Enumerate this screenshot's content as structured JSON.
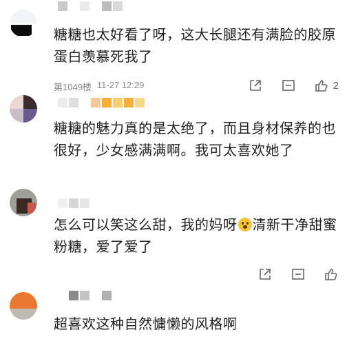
{
  "comments": [
    {
      "text": "糖糖也太好看了呀，这大长腿还有满脸的胶原蛋白羡慕死我了",
      "floor": "第1049楼",
      "time": "11-27 12:29",
      "like_count": "2",
      "avatar_colors": [
        "#0b0b0b",
        "#dfe7ee"
      ]
    },
    {
      "text": "糖糖的魅力真的是太绝了，而且身材保养的也很好，少女感满满啊。我可太喜欢她了",
      "avatar_colors": [
        "#3a2c2a",
        "#6a5b8e",
        "#e9d7d0"
      ]
    },
    {
      "text_before_emoji": "怎么可以笑这么甜，我的妈呀",
      "text_after_emoji": "清新干净甜蜜粉糖，爱了爱了",
      "emoji_name": "scared-face-emoji",
      "avatar_colors": [
        "#8b8f86",
        "#3b2a24"
      ]
    },
    {
      "text": "超喜欢这种自然慵懒的风格啊",
      "avatar_colors": [
        "#e9792e",
        "#bfb9b3"
      ]
    }
  ],
  "icons": {
    "share": "share-icon",
    "reply": "comment-icon",
    "like": "thumbs-up-icon"
  },
  "colors": {
    "text": "#222222",
    "meta": "#888888",
    "icon": "#666666",
    "username_mosaic_gold": "#f2b23a"
  }
}
